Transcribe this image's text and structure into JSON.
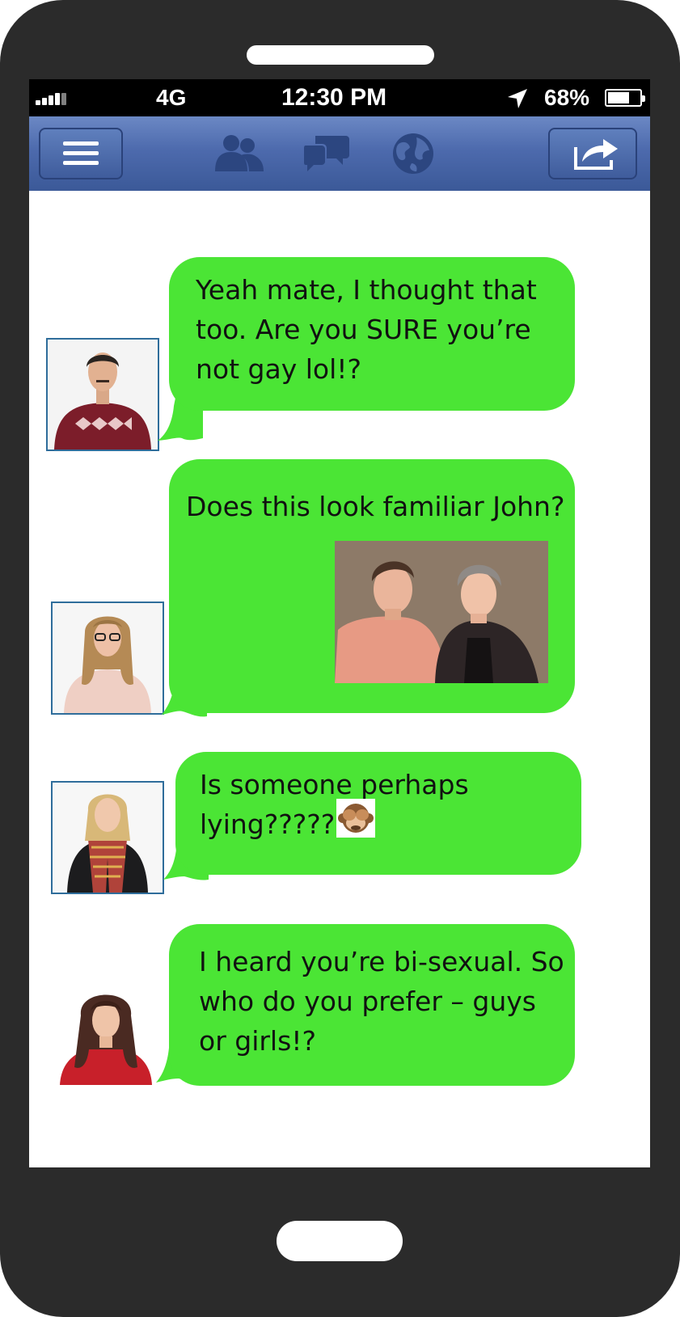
{
  "status_bar": {
    "carrier": "4G",
    "time": "12:30 PM",
    "battery": "68%",
    "battery_level": 0.68
  },
  "nav_bar": {
    "icons": [
      "menu-icon",
      "friends-icon",
      "messages-icon",
      "globe-icon",
      "share-icon"
    ]
  },
  "messages": [
    {
      "text": "Yeah mate, I thought that\ntoo. Are you SURE you’re\nnot gay lol!?",
      "sender_avatar": "man-red-sweater"
    },
    {
      "text": "Does this look familiar John?",
      "sender_avatar": "woman-glasses",
      "attachment": "photo-two-young-men"
    },
    {
      "text": "Is someone perhaps\nlying?????",
      "sender_avatar": "woman-plaid-scarf",
      "emoji": "see-no-evil-monkey"
    },
    {
      "text": "I heard you’re bi-sexual. So\nwho do you prefer – guys\nor girls!?",
      "sender_avatar": "woman-red-top"
    }
  ],
  "colors": {
    "bubble": "#4be535",
    "nav": "#3b5998",
    "phone_body": "#2b2b2b"
  }
}
